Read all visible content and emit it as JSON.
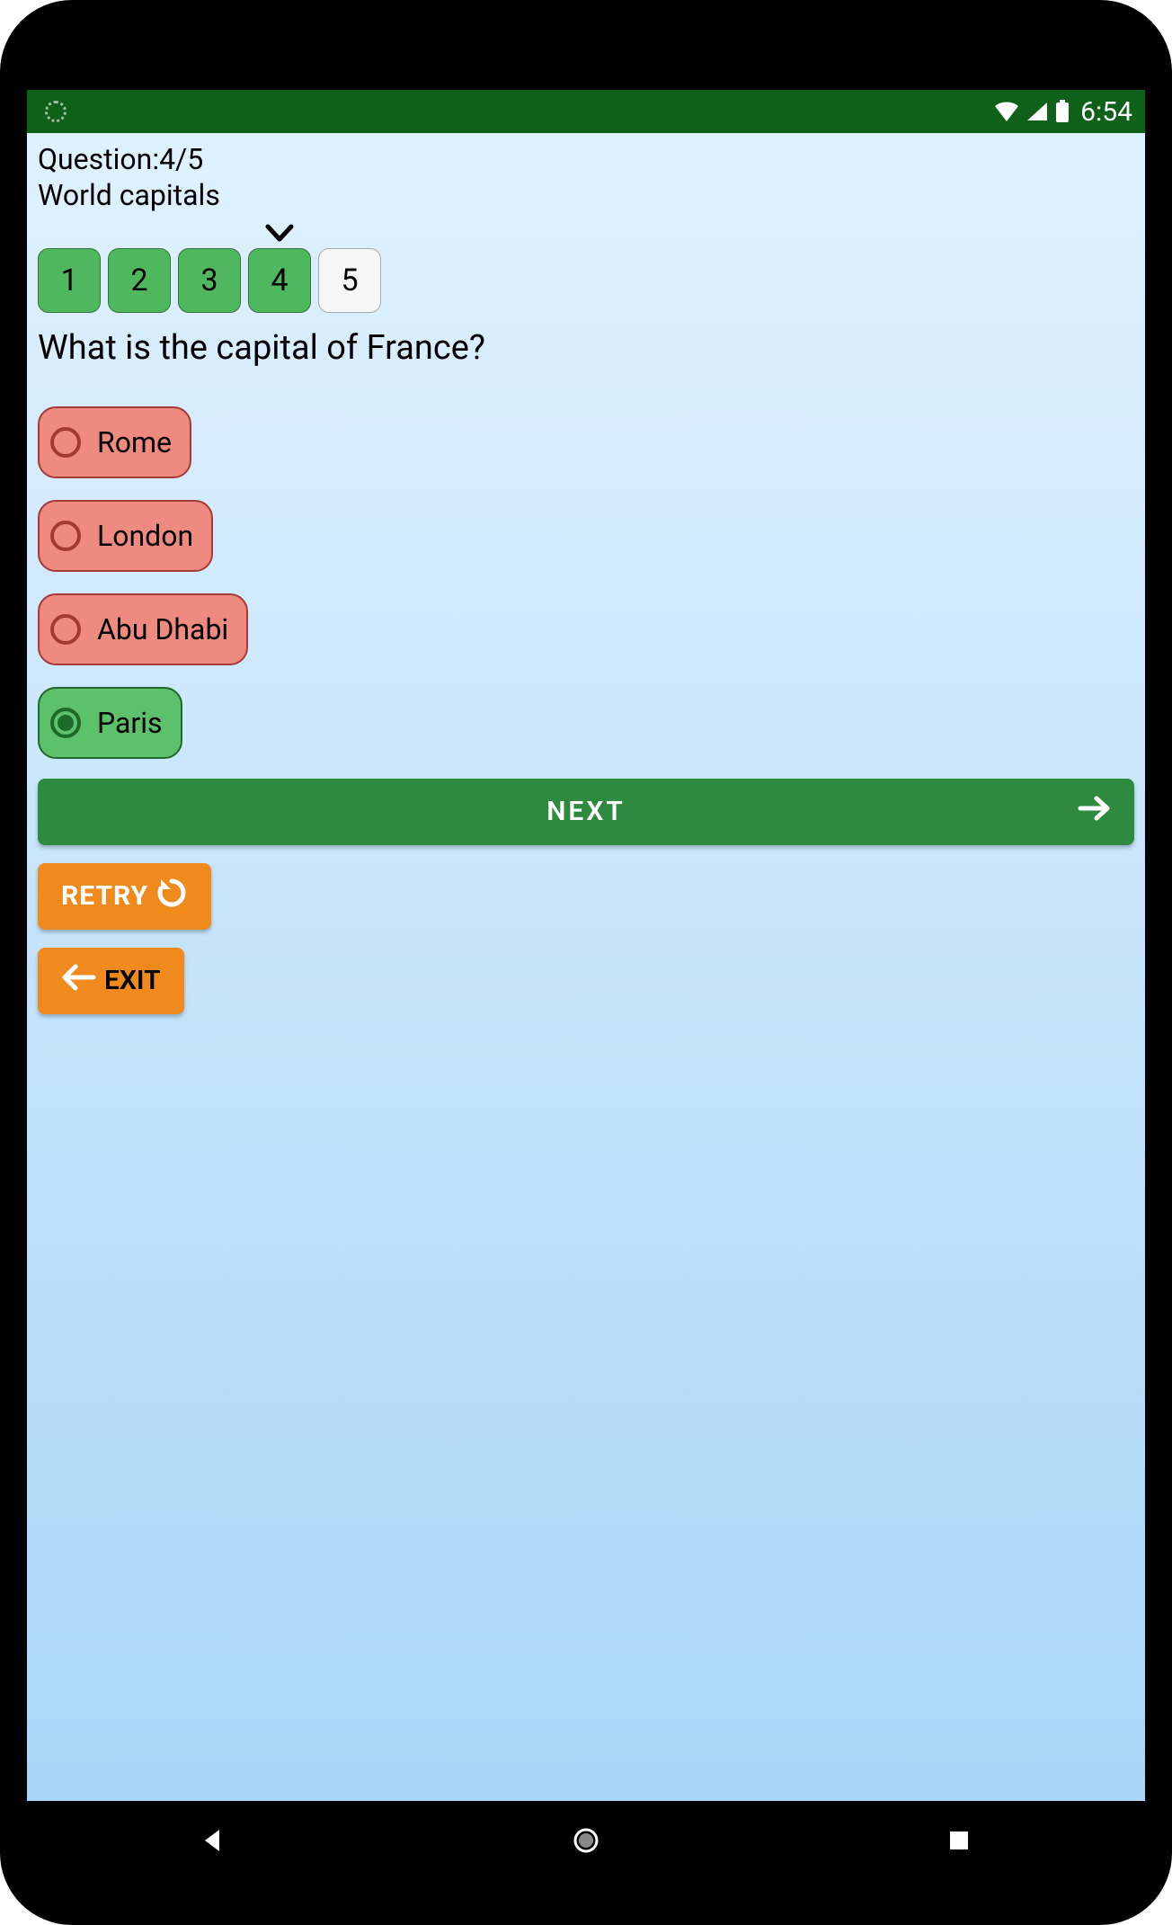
{
  "statusbar": {
    "time": "6:54"
  },
  "quiz": {
    "counter_label": "Question:4/5",
    "topic": "World capitals",
    "tracker": [
      {
        "n": "1",
        "state": "done"
      },
      {
        "n": "2",
        "state": "done"
      },
      {
        "n": "3",
        "state": "done"
      },
      {
        "n": "4",
        "state": "current"
      },
      {
        "n": "5",
        "state": "upcoming"
      }
    ],
    "question_text": "What is the capital of France?",
    "answers": [
      {
        "label": "Rome",
        "correct": false,
        "selected": false
      },
      {
        "label": "London",
        "correct": false,
        "selected": false
      },
      {
        "label": "Abu Dhabi",
        "correct": false,
        "selected": false
      },
      {
        "label": "Paris",
        "correct": true,
        "selected": true
      }
    ]
  },
  "buttons": {
    "next": "NEXT",
    "retry": "RETRY",
    "exit": "EXIT"
  }
}
